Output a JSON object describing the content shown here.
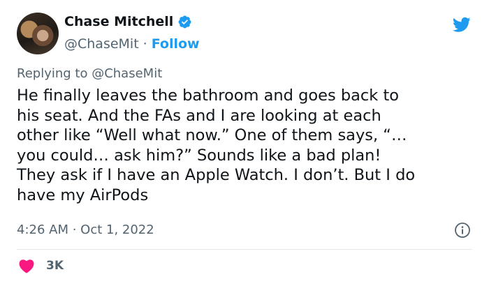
{
  "author": {
    "name": "Chase Mitchell",
    "handle": "@ChaseMit",
    "separator": "·",
    "follow_label": "Follow"
  },
  "reply": {
    "prefix": "Replying to ",
    "mention": "@ChaseMit"
  },
  "tweet": {
    "text": "He finally leaves the bathroom and goes back to\nhis seat. And the FAs and I are looking at each\nother like “Well what now.” One of them says, “…\nyou could… ask him?” Sounds like a bad plan!\nThey ask if I have an Apple Watch. I don’t. But I do\nhave my AirPods",
    "timestamp": "4:26 AM · Oct 1, 2022",
    "likes": "3K"
  },
  "colors": {
    "brand_blue": "#1d9bf0",
    "like_pink": "#f91880",
    "muted_text": "#536471"
  },
  "icons": [
    "verified-badge-icon",
    "twitter-bird-icon",
    "info-icon",
    "heart-icon"
  ]
}
